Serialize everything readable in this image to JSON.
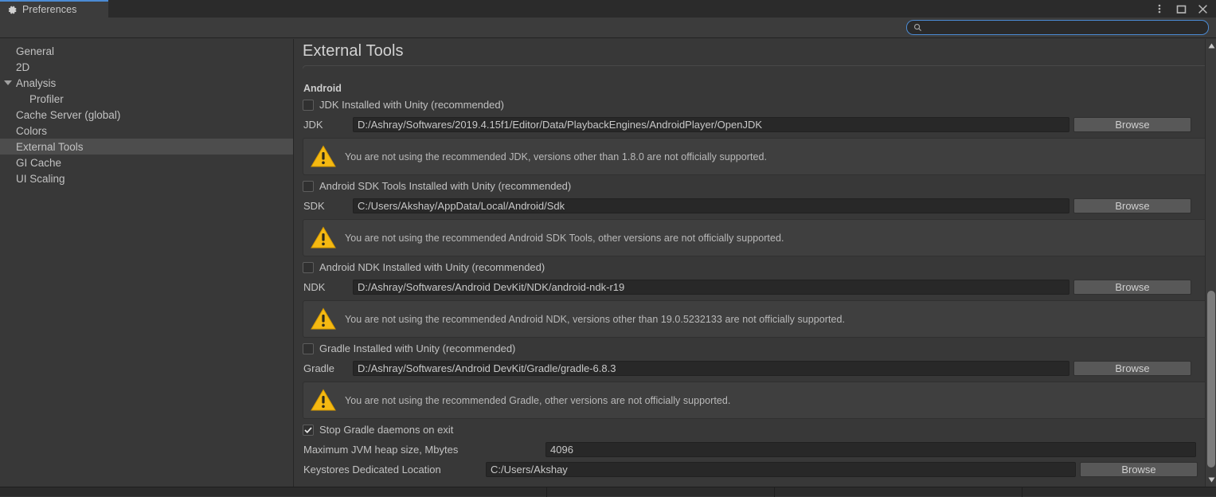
{
  "window": {
    "tab_label": "Preferences",
    "tab_icon": "gear-icon",
    "controls": [
      {
        "name": "more-menu-icon",
        "label": "⋮"
      },
      {
        "name": "maximize-icon",
        "label": "□"
      },
      {
        "name": "close-icon",
        "label": "✕"
      }
    ],
    "accent_color": "#4b8bd4"
  },
  "search": {
    "value": "",
    "placeholder": "",
    "icon": "search-icon"
  },
  "sidebar": {
    "items": [
      {
        "label": "General",
        "selected": false,
        "child": false,
        "expander": false
      },
      {
        "label": "2D",
        "selected": false,
        "child": false,
        "expander": false
      },
      {
        "label": "Analysis",
        "selected": false,
        "child": false,
        "expander": true
      },
      {
        "label": "Profiler",
        "selected": false,
        "child": true,
        "expander": false
      },
      {
        "label": "Cache Server (global)",
        "selected": false,
        "child": false,
        "expander": false
      },
      {
        "label": "Colors",
        "selected": false,
        "child": false,
        "expander": false
      },
      {
        "label": "External Tools",
        "selected": true,
        "child": false,
        "expander": false
      },
      {
        "label": "GI Cache",
        "selected": false,
        "child": false,
        "expander": false
      },
      {
        "label": "UI Scaling",
        "selected": false,
        "child": false,
        "expander": false
      }
    ]
  },
  "main": {
    "title": "External Tools",
    "section_header": "Android",
    "browse_label": "Browse",
    "warning_icon": "warning-triangle-icon",
    "groups": [
      {
        "checkbox_label": "JDK Installed with Unity (recommended)",
        "checked": false,
        "field_label": "JDK",
        "field_value": "D:/Ashray/Softwares/2019.4.15f1/Editor/Data/PlaybackEngines/AndroidPlayer/OpenJDK",
        "warning": "You are not using the recommended JDK, versions other than 1.8.0 are not officially supported."
      },
      {
        "checkbox_label": "Android SDK Tools Installed with Unity (recommended)",
        "checked": false,
        "field_label": "SDK",
        "field_value": "C:/Users/Akshay/AppData/Local/Android/Sdk",
        "warning": "You are not using the recommended Android SDK Tools, other versions are not officially supported."
      },
      {
        "checkbox_label": "Android NDK Installed with Unity (recommended)",
        "checked": false,
        "field_label": "NDK",
        "field_value": "D:/Ashray/Softwares/Android DevKit/NDK/android-ndk-r19",
        "warning": "You are not using the recommended Android NDK, versions other than 19.0.5232133 are not officially supported."
      },
      {
        "checkbox_label": "Gradle Installed with Unity (recommended)",
        "checked": false,
        "field_label": "Gradle",
        "field_value": "D:/Ashray/Softwares/Android DevKit/Gradle/gradle-6.8.3",
        "warning": "You are not using the recommended Gradle, other versions are not officially supported."
      }
    ],
    "stop_gradle": {
      "label": "Stop Gradle daemons on exit",
      "checked": true
    },
    "heap": {
      "label": "Maximum JVM heap size, Mbytes",
      "value": "4096"
    },
    "keystores": {
      "label": "Keystores Dedicated Location",
      "value": "C:/Users/Akshay"
    }
  }
}
